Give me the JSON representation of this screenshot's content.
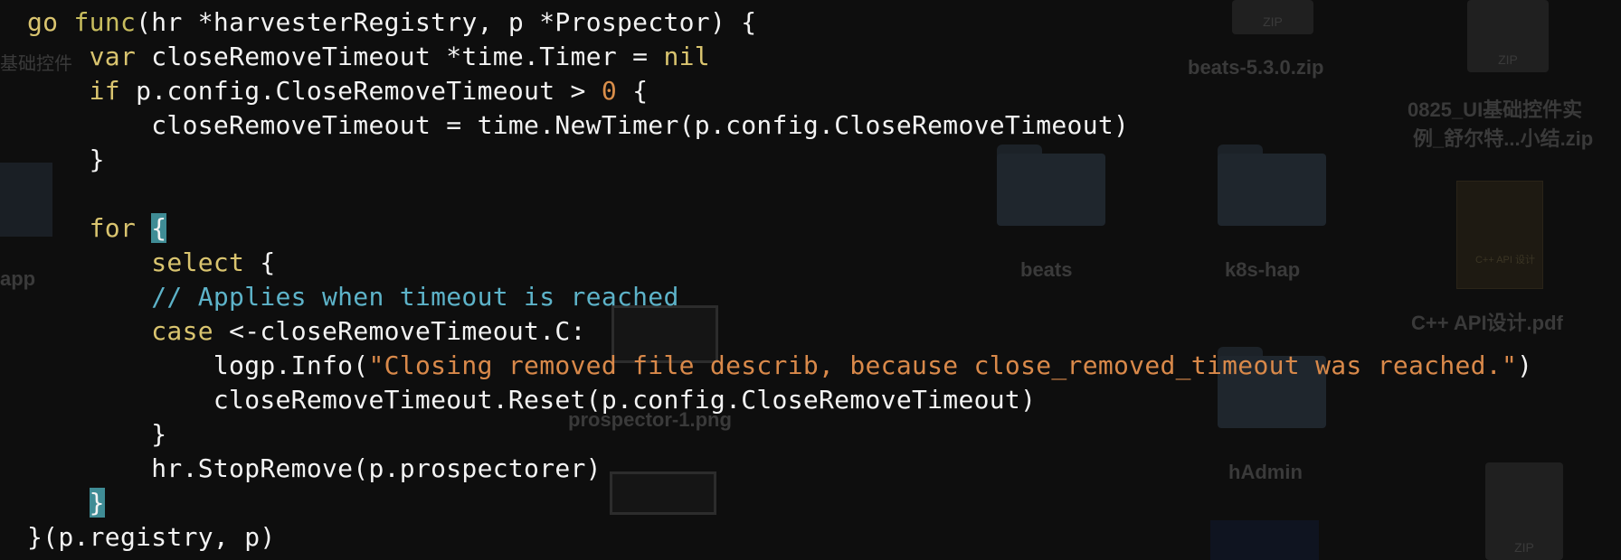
{
  "desktop": {
    "left_label": "基础控件",
    "app_label": "app",
    "items": {
      "beats_zip": "beats-5.3.0.zip",
      "ui_zip_line1": "0825_UI基础控件实",
      "ui_zip_line2": "例_舒尔特...小结.zip",
      "beats_folder": "beats",
      "k8s_folder": "k8s-hap",
      "cpp_pdf": "C++ API设计.pdf",
      "prospector_png": "prospector-1.png",
      "hadmin_folder": "hAdmin"
    },
    "zip_badge": "ZIP",
    "book_cover_text": "C++ API 设计"
  },
  "code": {
    "l1_a": "go",
    "l1_b": " ",
    "l1_c": "func",
    "l1_d": "(hr *harvesterRegistry, p *Prospector) {",
    "l2_kw": "var",
    "l2_rest": " closeRemoveTimeout *time.Timer = ",
    "l2_nil": "nil",
    "l3_kw": "if",
    "l3_rest": " p.config.CloseRemoveTimeout > ",
    "l3_num": "0",
    "l3_end": " {",
    "l4": "closeRemoveTimeout = time.NewTimer(p.config.CloseRemoveTimeout)",
    "l5": "}",
    "l7_kw": "for",
    "l7_brace": "{",
    "l8_kw": "select",
    "l8_rest": " {",
    "l9": "// Applies when timeout is reached",
    "l10_kw": "case",
    "l10_rest": " <-closeRemoveTimeout.C:",
    "l11_a": "logp.Info(",
    "l11_str": "\"Closing removed file describ, because close_removed_timeout was reached.\"",
    "l11_b": ")",
    "l12": "closeRemoveTimeout.Reset(p.config.CloseRemoveTimeout)",
    "l13": "}",
    "l14": "hr.StopRemove(p.prospectorer)",
    "l15_brace": "}",
    "l16": "}(p.registry, p)"
  },
  "colors": {
    "background": "#0e0e0e",
    "text": "#f3f3f3",
    "keyword": "#d9c46f",
    "number": "#d98e4a",
    "string": "#d9894a",
    "comment": "#5db3c9",
    "bracket_highlight": "#3f8c95"
  }
}
